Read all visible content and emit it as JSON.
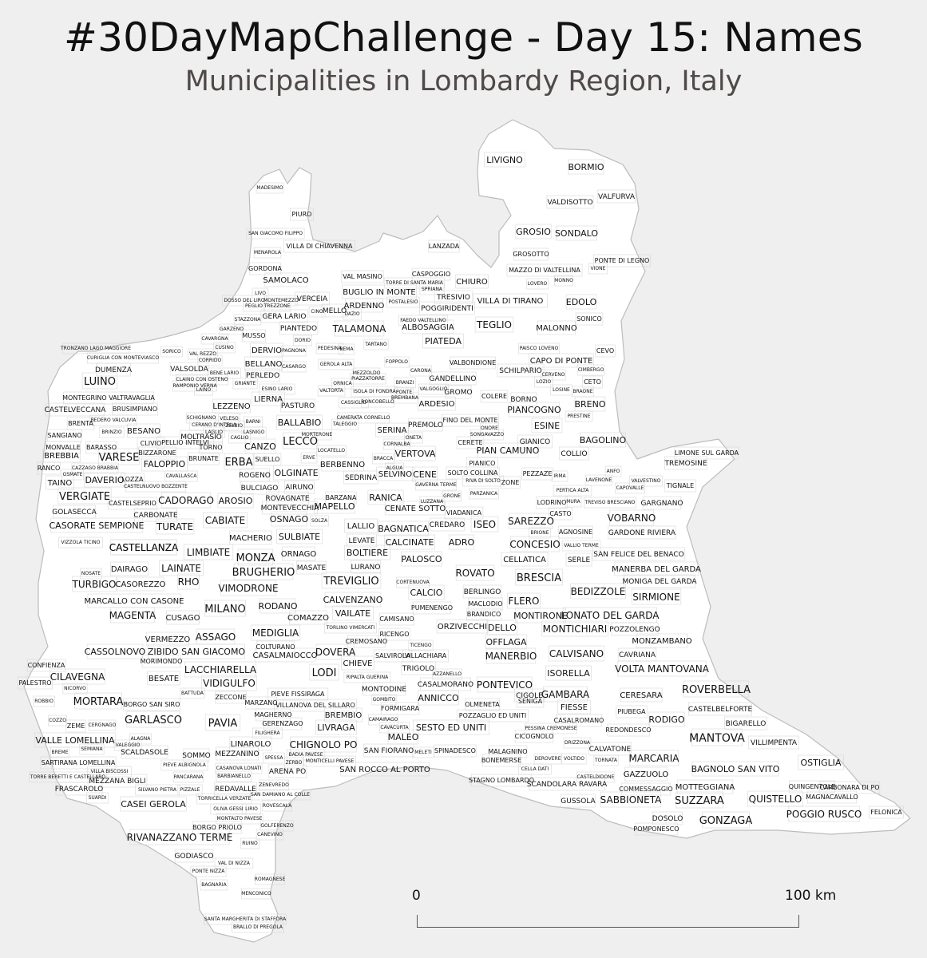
{
  "title": "#30DayMapChallenge - Day 15: Names",
  "subtitle": "Municipalities in Lombardy Region, Italy",
  "colors": {
    "background": "#efefef",
    "region_fill": "#ffffff",
    "boundary": "#bcbcbc",
    "label": "#111111"
  },
  "scale_bar": {
    "start_label": "0",
    "end_label": "100 km"
  },
  "municipalities": [
    "LIVIGNO",
    "BORMIO",
    "VALDISOTTO",
    "VALFURVA",
    "GROSIO",
    "SONDALO",
    "GROSOTTO",
    "MAZZO DI VALTELLINA",
    "PONTE DI LEGNO",
    "VIONE",
    "LOVERO",
    "MONNO",
    "MADESIMO",
    "PIURO",
    "SAN GIACOMO FILIPPO",
    "MENAROLA",
    "VILLA DI CHIAVENNA",
    "LANZADA",
    "GORDONA",
    "SAMOLACO",
    "VAL MASINO",
    "CASPOGGIO",
    "TORRE DI SANTA MARIA",
    "SPRIANA",
    "CHIURO",
    "BUGLIO IN MONTE",
    "POSTALESIO",
    "TRESIVIO",
    "POGGIRIDENTI",
    "VILLA DI TIRANO",
    "EDOLO",
    "SONICO",
    "LIVO",
    "DOSSO DEL LIRO",
    "MONTEMEZZO",
    "PEGLIO",
    "TREZZONE",
    "VERCEIA",
    "CINO",
    "MELLO",
    "DAZIO",
    "ARDENNO",
    "GERA LARIO",
    "STAZZONA",
    "FAEDO VALTELLINO",
    "ALBOSAGGIA",
    "TEGLIO",
    "MALONNO",
    "GARZENO",
    "PIANTEDO",
    "TALAMONA",
    "MUSSO",
    "CAVARGNA",
    "TARTANO",
    "PIATEDA",
    "CUSINO",
    "DORIO",
    "DERVIO",
    "PAGNONA",
    "PEDESINA",
    "BEMA",
    "PAISCO LOVENO",
    "CEVO",
    "SORICO",
    "VAL REZZO",
    "CORRIDO",
    "FOPPOLO",
    "VALBONDIONE",
    "CAPO DI PONTE",
    "BELLANO",
    "CARONA",
    "GEROLA ALTA",
    "CERVENO",
    "CIMBERGO",
    "MEZZOLDO",
    "SCHILPARIO",
    "LOZIO",
    "CETO",
    "BENE LARIO",
    "VALSOLDA",
    "CLAINO CON OSTENO",
    "PERLEDO",
    "GRIANTE",
    "ORNICA",
    "CASARGO",
    "VALTORTA",
    "PIAZZATORRE",
    "BRANZI",
    "VALGOGLIO",
    "GANDELLINO",
    "LOSINE",
    "BRAONE",
    "PONTE",
    "BREMBANA",
    "LAINO",
    "RAMPONIO VERNA",
    "ESINO LARIO",
    "LIERNA",
    "CASSIGLIO",
    "ISOLA DI FONDRA",
    "RONCOBELLO",
    "ARDESIO",
    "GROMO",
    "COLERE",
    "BORNO",
    "BRENO",
    "LEZZENO",
    "PASTURO",
    "CAMERATA CORNELLO",
    "TALEGGIO",
    "SERINA",
    "PREMOLO",
    "FINO DEL MONTE",
    "PIANCOGNO",
    "PRESTINE",
    "ESINE",
    "SCHIGNANO",
    "VELESO",
    "BARNI",
    "CERANO D'INTELVI",
    "LAGLIO",
    "ZELBIO",
    "MOLTRASIO",
    "CAGLIO",
    "LASNIGO",
    "BALLABIO",
    "MORTERONE",
    "ONETA",
    "CORNALBA",
    "ONORE",
    "SONGAVAZZO",
    "GIANICO",
    "BAGOLINO",
    "TORNO",
    "CANZO",
    "LECCO",
    "CERETE",
    "PIAN CAMUNO",
    "COLLIO",
    "PELLIO INTELVI",
    "CLIVIO",
    "BRUNATE",
    "SUELLO",
    "LOCATELLO",
    "ERVE",
    "BRACCA",
    "ALGUA",
    "VERTOVA",
    "PIANICO",
    "LIMONE SUL GARDA",
    "TREMOSINE",
    "ANFO",
    "BIZZARONE",
    "ERBA",
    "OLGINATE",
    "BERBENNO",
    "SELVINO",
    "SOLTO COLLINA",
    "RIVA DI SOLTO",
    "PEZZAZE",
    "VALVESTINO",
    "CAVALLASCA",
    "ROGENO",
    "SEDRINA",
    "CENE",
    "GAVERNA TERME",
    "PARZANICA",
    "CAPOVALLE",
    "PERTICA ALTA",
    "IRMA",
    "LAVENONE",
    "TIGNALE",
    "FALOPPIO",
    "CASTELNUOVO BOZZENTE",
    "AIRUNO",
    "BULCIAGO",
    "RANICA",
    "ZONE",
    "GRONE",
    "LUZZANA",
    "MONTEVECCHIA",
    "BARZANA",
    "MAPELLO",
    "CENATE SOTTO",
    "VIADANICA",
    "LODRINO",
    "MURA",
    "TREVISO BRESCIANO",
    "GARGNANO",
    "ROVAGNATE",
    "CADORAGO",
    "AROSIO",
    "OSNAGO",
    "SOLZA",
    "BAGNATICA",
    "CREDARO",
    "ISEO",
    "SAREZZO",
    "CASTO",
    "VOBARNO",
    "GARDONE RIVIERA",
    "CASTELSEPRIO",
    "CARBONATE",
    "TURATE",
    "CABIATE",
    "LALLIO",
    "AGNOSINE",
    "BRIONE",
    "CASORATE SEMPIONE",
    "LEVATE",
    "CALCINATE",
    "ADRO",
    "CONCESIO",
    "VALLIO TERME",
    "SAN FELICE DEL BENACO",
    "MACHERIO",
    "SULBIATE",
    "BOLTIERE",
    "PALOSCO",
    "CELLATICA",
    "SERLE",
    "CASTELLANZA",
    "LIMBIATE",
    "ORNAGO",
    "MANERBA DEL GARDA",
    "MONZA",
    "LURANO",
    "ROVATO",
    "MONIGA DEL GARDA",
    "NOSATE",
    "DAIRAGO",
    "LAINATE",
    "BRUGHERIO",
    "MASATE",
    "CORTENUOVA",
    "BRESCIA",
    "TURBIGO",
    "CASOREZZO",
    "RHO",
    "TREVIGLIO",
    "BEDIZZOLE",
    "SIRMIONE",
    "VIMODRONE",
    "BERLINGO",
    "CALCIO",
    "MARCALLO CON CASONE",
    "CALVENZANO",
    "MACLODIO",
    "FLERO",
    "MAGENTA",
    "CUSAGO",
    "MILANO",
    "RODANO",
    "VAILATE",
    "PUMENENGO",
    "BRANDICO",
    "MONTIRONE",
    "LONATO DEL GARDA",
    "COMAZZO",
    "CAMISANO",
    "TORLINO VIMERCATI",
    "ORZIVECCHI",
    "DELLO",
    "POZZOLENGO",
    "VERMEZZO",
    "ASSAGO",
    "MEDIGLIA",
    "RICENGO",
    "MONTICHIARI",
    "MONZAMBANO",
    "ZIBIDO SAN GIACOMO",
    "COLTURANO",
    "CREMOSANO",
    "TICENGO",
    "OFFLAGA",
    "CAVRIANA",
    "CASSOLNOVO",
    "CASALMAIOCCO",
    "DOVERA",
    "SALVIROLA",
    "VILLACHIARA",
    "MANERBIO",
    "CALVISANO",
    "VOLTA MANTOVANA",
    "MORIMONDO",
    "CHIEVE",
    "TRIGOLO",
    "ISORELLA",
    "CONFIENZA",
    "LACCHIARELLA",
    "LODI",
    "RIPALTA GUERINA",
    "AZZANELLO",
    "CILAVEGNA",
    "BESATE",
    "VIDIGULFO",
    "CASALMORANO",
    "PONTEVICO",
    "CIGOLE",
    "ROVERBELLA",
    "PALESTRO",
    "NICORVO",
    "BATTUDA",
    "MONTODINE",
    "GAMBARA",
    "CERESARA",
    "ROBBIO",
    "ZECCONE",
    "MARZANO",
    "PIEVE FISSIRAGA",
    "ANNICCO",
    "MORTARA",
    "BORGO SAN SIRO",
    "VILLANOVA DEL SILLARO",
    "GOMBITO",
    "OLMENETA",
    "SENIGA",
    "FIESSE",
    "CASTELBELFORTE",
    "MAGHERNO",
    "FORMIGARA",
    "POZZAGLIO ED UNITI",
    "PIUBEGA",
    "BIGARELLO",
    "COZZO",
    "CERGNAGO",
    "GARLASCO",
    "BREMBIO",
    "CAMAIRAGO",
    "RODIGO",
    "ZEME",
    "PAVIA",
    "GERENZAGO",
    "LIVRAGA",
    "CAVACURTA",
    "SESTO ED UNITI",
    "PESSINA CREMONESE",
    "CASALROMANO",
    "REDONDESCO",
    "FILIGHERA",
    "MALEO",
    "CICOGNOLO",
    "MANTOVA",
    "VILLIMPENTA",
    "ALAGNA",
    "VALLE LOMELLINA",
    "LINAROLO",
    "CHIGNOLO PO",
    "DRIZZONA",
    "BREME",
    "SEMIANA",
    "SCALDASOLE",
    "SOMMO",
    "MEZZANINO",
    "SPESSA",
    "BADIA PAVESE",
    "SAN FIORANO",
    "MELETI",
    "SPINADESCO",
    "CALVATONE",
    "OSTIGLIA",
    "SARTIRANA LOMELLINA",
    "VALEGGIO",
    "PIEVE ALBIGNOLA",
    "ZERBO",
    "MONTICELLI PAVESE",
    "MALAGNINO",
    "BONEMERSE",
    "DEROVERE",
    "VOLTIDO",
    "TORNATA",
    "MARCARIA",
    "BAGNOLO SAN VITO",
    "VILLA BISCOSSI",
    "CASANOVA LONATI",
    "ARENA PO",
    "SAN ROCCO AL PORTO",
    "CELLA DATI",
    "GAZZUOLO",
    "TORRE BERETTI E CASTELLARO",
    "MEZZANA BIGLI",
    "BARBIANELLO",
    "CASTELDIDONE",
    "QUINGENTOLE",
    "CARBONARA DI PO",
    "FRASCAROLO",
    "SILVANO PIETRA",
    "PANCARANA",
    "REDAVALLE",
    "ZENEVREDO",
    "STAGNO LOMBARDO",
    "SCANDOLARA RAVARA",
    "COMMESSAGGIO",
    "MOTTEGGIANA",
    "QUISTELLO",
    "MAGNACAVALLO",
    "SUARDI",
    "PIZZALE",
    "TORRICELLA VERZATE",
    "SAN DAMIANO AL COLLE",
    "GUSSOLA",
    "SABBIONETA",
    "SUZZARA",
    "CASEI GEROLA",
    "ROVESCALA",
    "OLIVA GESSI",
    "LIRIO",
    "POGGIO RUSCO",
    "FELONICA",
    "MONTALTO PAVESE",
    "DOSOLO",
    "GONZAGA",
    "BORGO PRIOLO",
    "GOLFERENZO",
    "POMPONESCO",
    "RIVANAZZANO TERME",
    "CANEVINO",
    "RUINO",
    "GODIASCO",
    "VAL DI NIZZA",
    "PONTE NIZZA",
    "ROMAGNESE",
    "BAGNARIA",
    "MENCONICO",
    "SANTA MARGHERITA DI STAFFORA",
    "BRALLO DI PREGOLA",
    "TRONZANO LAGO MAGGIORE",
    "CURIGLIA CON MONTEVIASCO",
    "DUMENZA",
    "LUINO",
    "MONTEGRINO VALTRAVAGLIA",
    "CASTELVECCANA",
    "BRUSIMPIANO",
    "BRENTA",
    "BEDERO VALCUVIA",
    "SANGIANO",
    "BRINZIO",
    "BESANO",
    "MONVALLE",
    "BARASSO",
    "BREBBIA",
    "VARESE",
    "RANCO",
    "CAZZAGO BRABBIA",
    "OSMATE",
    "DAVERIO",
    "LOZZA",
    "TAINO",
    "VERGIATE",
    "GOLASECCA",
    "VIZZOLA TICINO",
    "CASTELLANZA"
  ]
}
